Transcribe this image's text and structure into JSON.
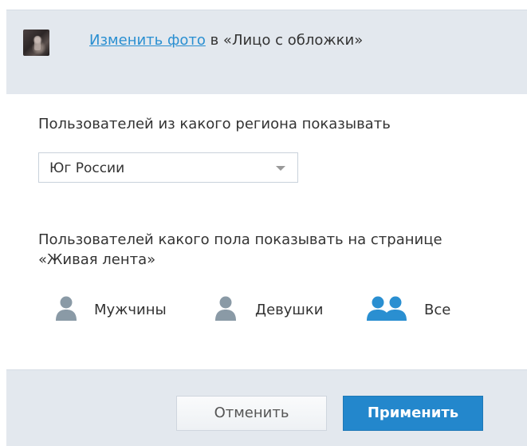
{
  "header": {
    "link_text": "Изменить фото",
    "suffix_text": " в «Лицо с обложки»"
  },
  "region": {
    "label": "Пользователей из какого региона показывать",
    "selected": "Юг России"
  },
  "gender": {
    "label": "Пользователей какого пола показывать на странице «Живая лента»",
    "options": [
      {
        "label": "Мужчины",
        "icon": "user-icon",
        "selected": false
      },
      {
        "label": "Девушки",
        "icon": "user-icon",
        "selected": false
      },
      {
        "label": "Все",
        "icon": "users-icon",
        "selected": true
      }
    ]
  },
  "footer": {
    "cancel_label": "Отменить",
    "apply_label": "Применить"
  },
  "colors": {
    "link": "#2a8fd1",
    "panel": "#e3e8ee",
    "primary_button": "#2387cc",
    "icon_inactive": "#8a9aa6",
    "icon_active": "#2a8fd1"
  }
}
